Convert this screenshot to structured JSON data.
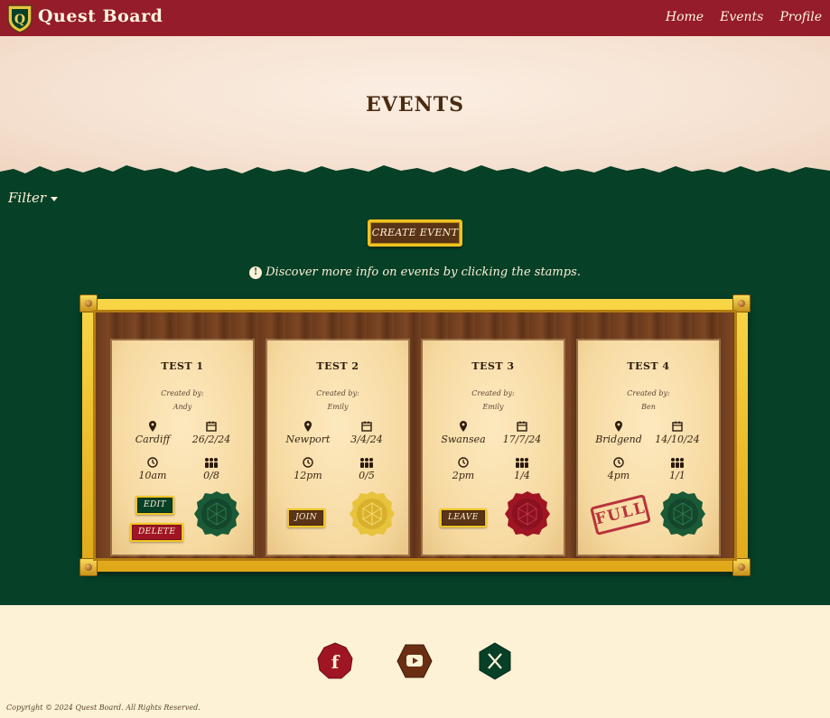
{
  "header": {
    "brand": "Quest Board",
    "nav": {
      "home": "Home",
      "events": "Events",
      "profile": "Profile"
    }
  },
  "hero": {
    "title": "EVENTS"
  },
  "toolbar": {
    "filter_label": "Filter",
    "create_label": "CREATE EVENT",
    "info_text": "Discover more info on events by clicking the stamps."
  },
  "events": [
    {
      "title": "TEST 1",
      "created_by_label": "Created by:",
      "creator": "Andy",
      "location": "Cardiff",
      "date": "26/2/24",
      "time": "10am",
      "players": "0/8",
      "actions": [
        "EDIT",
        "DELETE"
      ],
      "stamp_color": "#1a5a36"
    },
    {
      "title": "TEST 2",
      "created_by_label": "Created by:",
      "creator": "Emily",
      "location": "Newport",
      "date": "3/4/24",
      "time": "12pm",
      "players": "0/5",
      "actions": [
        "JOIN"
      ],
      "stamp_color": "#e8c43c"
    },
    {
      "title": "TEST 3",
      "created_by_label": "Created by:",
      "creator": "Emily",
      "location": "Swansea",
      "date": "17/7/24",
      "time": "2pm",
      "players": "1/4",
      "actions": [
        "LEAVE"
      ],
      "stamp_color": "#a01524"
    },
    {
      "title": "TEST 4",
      "created_by_label": "Created by:",
      "creator": "Ben",
      "location": "Bridgend",
      "date": "14/10/24",
      "time": "4pm",
      "players": "1/1",
      "status_stamp": "FULL",
      "stamp_color": "#1a5a36"
    }
  ],
  "footer": {
    "social": [
      "facebook-icon",
      "youtube-icon",
      "x-icon"
    ],
    "copyright": "Copyright © 2024 Quest Board. All Rights Reserved."
  },
  "colors": {
    "header": "#951c29",
    "main": "#064027",
    "accent_gold": "#f2c623",
    "brown": "#5a3416"
  }
}
